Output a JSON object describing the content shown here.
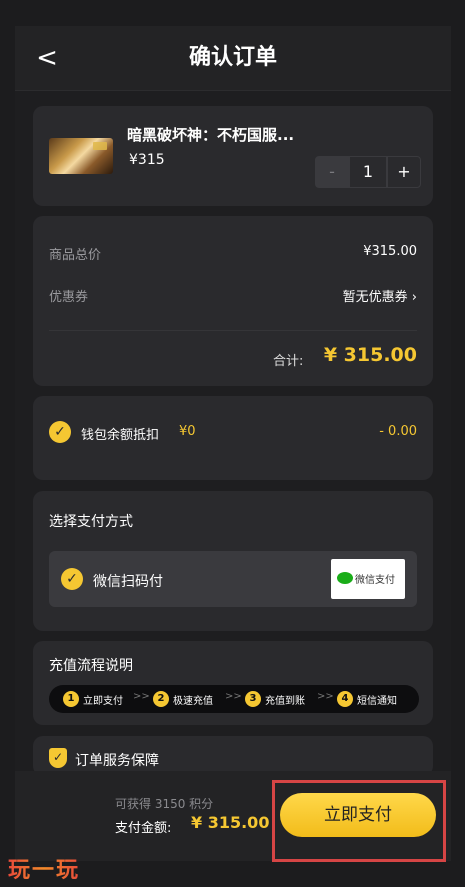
{
  "header": {
    "back_glyph": "<",
    "title": "确认订单"
  },
  "product": {
    "name": "暗黑破坏神：不朽国服...",
    "price": "¥315",
    "quantity": "1",
    "minus": "-",
    "plus": "+"
  },
  "summary": {
    "total_label": "商品总价",
    "total_value": "¥315.00",
    "coupon_label": "优惠券",
    "coupon_value": "暂无优惠券 ›",
    "sum_label": "合计:",
    "sum_value": "¥ 315.00"
  },
  "wallet": {
    "label": "钱包余额抵扣",
    "balance": "¥0",
    "deduction": "- 0.00",
    "checked": true
  },
  "payment": {
    "section_title": "选择支付方式",
    "option_label": "微信扫码付",
    "logo_text": "微信支付",
    "checked": true
  },
  "flow": {
    "section_title": "充值流程说明",
    "steps": [
      {
        "num": "1",
        "label": "立即支付"
      },
      {
        "num": "2",
        "label": "极速充值"
      },
      {
        "num": "3",
        "label": "充值到账"
      },
      {
        "num": "4",
        "label": "短信通知"
      }
    ],
    "arrow": ">>"
  },
  "guarantee": {
    "title": "订单服务保障"
  },
  "bottom": {
    "points_text": "可获得 3150 积分",
    "pay_label": "支付金额:",
    "pay_value": "¥ 315.00",
    "pay_button": "立即支付"
  },
  "watermark": "玩一玩",
  "colors": {
    "accent": "#f5c732",
    "background": "#1e1e20",
    "card": "#2a2a2d",
    "highlight": "#d64545"
  }
}
